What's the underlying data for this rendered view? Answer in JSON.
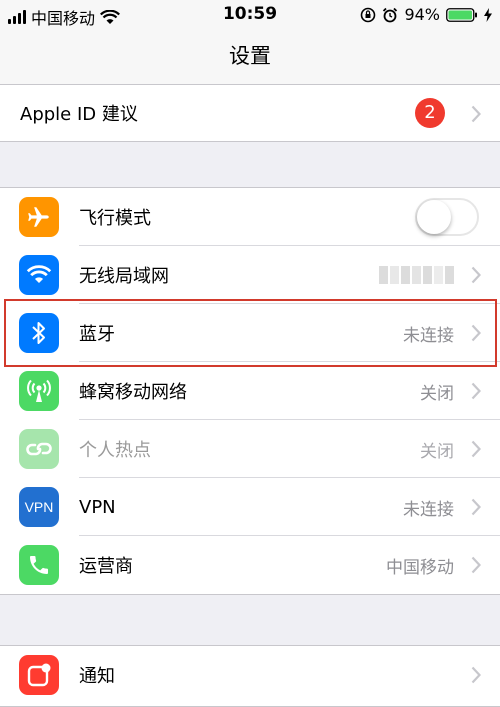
{
  "status_bar": {
    "carrier": "中国移动",
    "time": "10:59",
    "battery": "94%"
  },
  "nav": {
    "title": "设置"
  },
  "apple_id": {
    "label": "Apple ID 建议",
    "badge": "2"
  },
  "settings": [
    {
      "label": "飞行模式",
      "value": "",
      "icon": "airplane-icon",
      "color": "#ff9500"
    },
    {
      "label": "无线局域网",
      "value": "",
      "icon": "wifi-icon",
      "color": "#007aff"
    },
    {
      "label": "蓝牙",
      "value": "未连接",
      "icon": "bluetooth-icon",
      "color": "#007aff"
    },
    {
      "label": "蜂窝移动网络",
      "value": "关闭",
      "icon": "cellular-icon",
      "color": "#4cd964"
    },
    {
      "label": "个人热点",
      "value": "关闭",
      "icon": "hotspot-icon",
      "color": "#a6e5ac"
    },
    {
      "label": "VPN",
      "value": "未连接",
      "icon": "vpn-icon",
      "color": "#2270d0",
      "icon_text": "VPN"
    },
    {
      "label": "运营商",
      "value": "中国移动",
      "icon": "phone-icon",
      "color": "#4cd964"
    }
  ],
  "notifications": {
    "label": "通知",
    "icon": "notification-icon",
    "color": "#ff3b30"
  }
}
